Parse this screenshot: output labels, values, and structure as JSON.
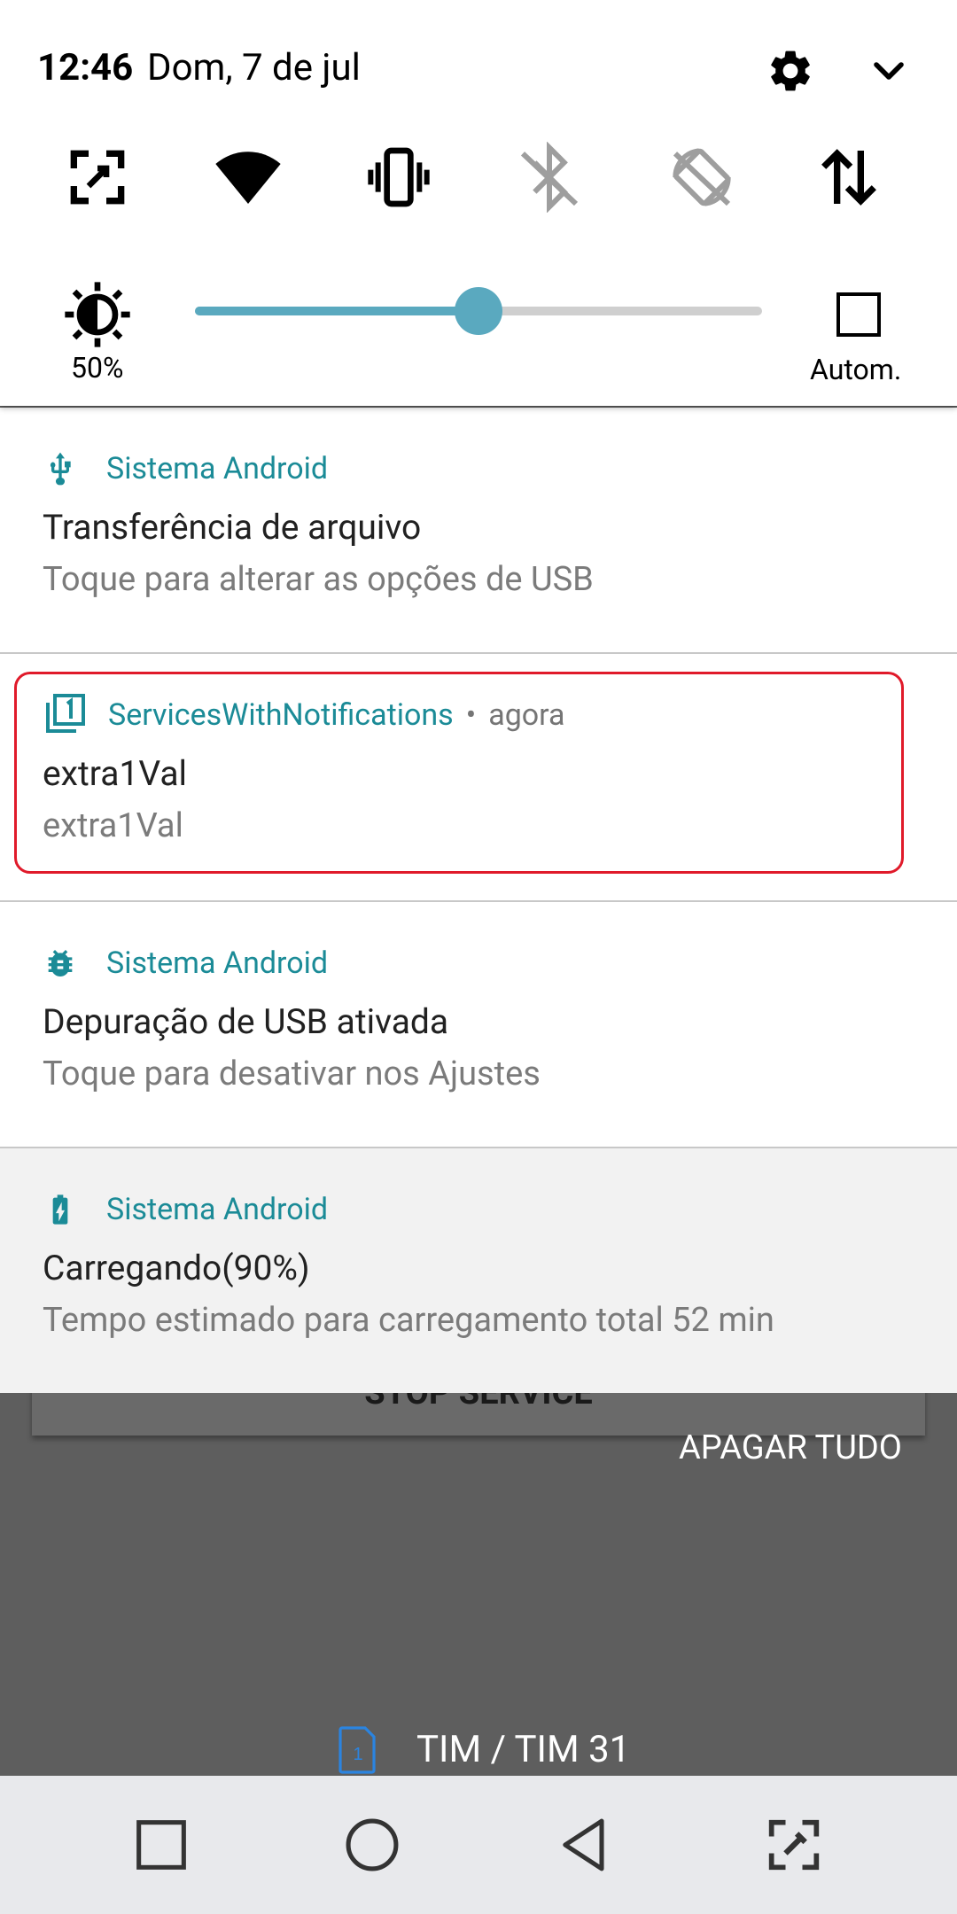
{
  "status_bar": {
    "time": "12:46",
    "date": "Dom, 7 de jul"
  },
  "quick_settings": {
    "tiles": [
      {
        "name": "screenshot-tile",
        "icon": "screenshot-icon",
        "enabled": true
      },
      {
        "name": "wifi-tile",
        "icon": "wifi-icon",
        "enabled": true
      },
      {
        "name": "vibrate-tile",
        "icon": "vibrate-icon",
        "enabled": true
      },
      {
        "name": "bluetooth-tile",
        "icon": "bluetooth-off-icon",
        "enabled": false
      },
      {
        "name": "rotation-tile",
        "icon": "rotation-lock-icon",
        "enabled": false
      },
      {
        "name": "data-tile",
        "icon": "mobile-data-icon",
        "enabled": true
      }
    ],
    "brightness": {
      "percent_label": "50%",
      "level": 0.5,
      "auto_label": "Autom."
    }
  },
  "notifications": [
    {
      "app": "Sistema Android",
      "title": "Transferência de arquivo",
      "text": "Toque para alterar as opções de USB",
      "icon": "usb-icon"
    },
    {
      "app": "ServicesWithNotifications",
      "time": "agora",
      "title": "extra1Val",
      "text": "extra1Val",
      "icon": "app-notification-icon",
      "highlighted": true
    },
    {
      "app": "Sistema Android",
      "title": "Depuração de USB ativada",
      "text": "Toque para desativar nos Ajustes",
      "icon": "bug-icon"
    },
    {
      "app": "Sistema Android",
      "title": "Carregando(90%)",
      "text": "Tempo estimado para carregamento total 52 min",
      "icon": "battery-charging-icon"
    }
  ],
  "background_app": {
    "button_label": "STOP SERVICE"
  },
  "clear_all_label": "APAGAR TUDO",
  "carrier": {
    "sim_number": "1",
    "label": "TIM / TIM 31"
  },
  "colors": {
    "accent": "#1b8b97",
    "slider": "#5aa9bf",
    "highlight": "#e01a2a"
  }
}
